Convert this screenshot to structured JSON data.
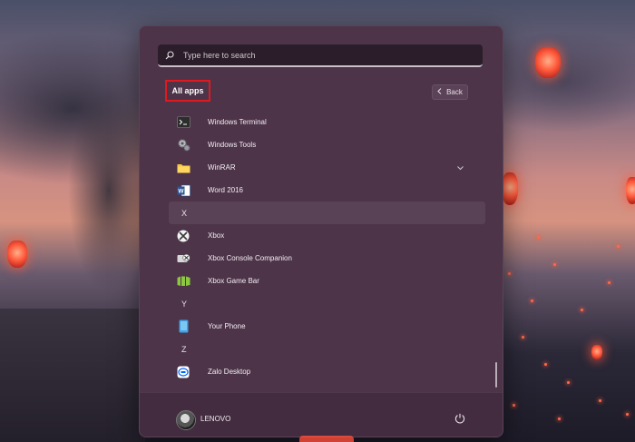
{
  "search": {
    "placeholder": "Type here to search",
    "icon": "search-icon"
  },
  "header": {
    "title": "All apps",
    "back_label": "Back"
  },
  "apps": [
    {
      "type": "app",
      "label": "Windows Terminal",
      "icon": "terminal-icon"
    },
    {
      "type": "app",
      "label": "Windows Tools",
      "icon": "gear-tools-icon"
    },
    {
      "type": "app",
      "label": "WinRAR",
      "icon": "folder-icon",
      "expandable": true
    },
    {
      "type": "app",
      "label": "Word 2016",
      "icon": "word-icon"
    },
    {
      "type": "letter",
      "label": "X"
    },
    {
      "type": "app",
      "label": "Xbox",
      "icon": "xbox-icon"
    },
    {
      "type": "app",
      "label": "Xbox Console Companion",
      "icon": "xbox-companion-icon"
    },
    {
      "type": "app",
      "label": "Xbox Game Bar",
      "icon": "game-bar-icon"
    },
    {
      "type": "letter",
      "label": "Y"
    },
    {
      "type": "app",
      "label": "Your Phone",
      "icon": "phone-icon"
    },
    {
      "type": "letter",
      "label": "Z"
    },
    {
      "type": "app",
      "label": "Zalo Desktop",
      "icon": "zalo-icon"
    }
  ],
  "footer": {
    "username": "LENOVO",
    "power_icon": "power-icon"
  },
  "colors": {
    "menu_bg": "#4d3449",
    "highlight_border": "#e0191e",
    "accent_green": "#8dc63f",
    "word_blue": "#2b5797"
  }
}
